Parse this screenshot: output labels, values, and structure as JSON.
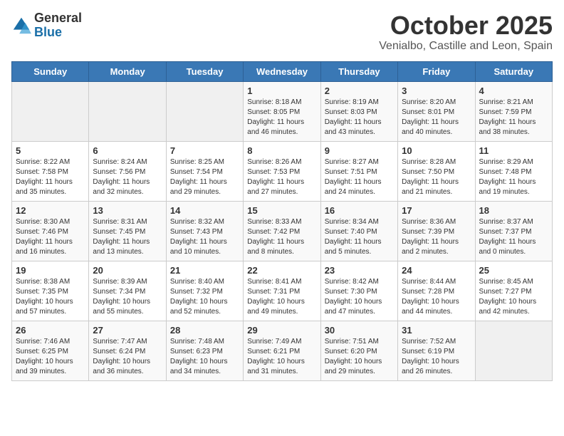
{
  "header": {
    "logo_general": "General",
    "logo_blue": "Blue",
    "month": "October 2025",
    "location": "Venialbo, Castille and Leon, Spain"
  },
  "weekdays": [
    "Sunday",
    "Monday",
    "Tuesday",
    "Wednesday",
    "Thursday",
    "Friday",
    "Saturday"
  ],
  "weeks": [
    [
      {
        "day": "",
        "info": ""
      },
      {
        "day": "",
        "info": ""
      },
      {
        "day": "",
        "info": ""
      },
      {
        "day": "1",
        "info": "Sunrise: 8:18 AM\nSunset: 8:05 PM\nDaylight: 11 hours\nand 46 minutes."
      },
      {
        "day": "2",
        "info": "Sunrise: 8:19 AM\nSunset: 8:03 PM\nDaylight: 11 hours\nand 43 minutes."
      },
      {
        "day": "3",
        "info": "Sunrise: 8:20 AM\nSunset: 8:01 PM\nDaylight: 11 hours\nand 40 minutes."
      },
      {
        "day": "4",
        "info": "Sunrise: 8:21 AM\nSunset: 7:59 PM\nDaylight: 11 hours\nand 38 minutes."
      }
    ],
    [
      {
        "day": "5",
        "info": "Sunrise: 8:22 AM\nSunset: 7:58 PM\nDaylight: 11 hours\nand 35 minutes."
      },
      {
        "day": "6",
        "info": "Sunrise: 8:24 AM\nSunset: 7:56 PM\nDaylight: 11 hours\nand 32 minutes."
      },
      {
        "day": "7",
        "info": "Sunrise: 8:25 AM\nSunset: 7:54 PM\nDaylight: 11 hours\nand 29 minutes."
      },
      {
        "day": "8",
        "info": "Sunrise: 8:26 AM\nSunset: 7:53 PM\nDaylight: 11 hours\nand 27 minutes."
      },
      {
        "day": "9",
        "info": "Sunrise: 8:27 AM\nSunset: 7:51 PM\nDaylight: 11 hours\nand 24 minutes."
      },
      {
        "day": "10",
        "info": "Sunrise: 8:28 AM\nSunset: 7:50 PM\nDaylight: 11 hours\nand 21 minutes."
      },
      {
        "day": "11",
        "info": "Sunrise: 8:29 AM\nSunset: 7:48 PM\nDaylight: 11 hours\nand 19 minutes."
      }
    ],
    [
      {
        "day": "12",
        "info": "Sunrise: 8:30 AM\nSunset: 7:46 PM\nDaylight: 11 hours\nand 16 minutes."
      },
      {
        "day": "13",
        "info": "Sunrise: 8:31 AM\nSunset: 7:45 PM\nDaylight: 11 hours\nand 13 minutes."
      },
      {
        "day": "14",
        "info": "Sunrise: 8:32 AM\nSunset: 7:43 PM\nDaylight: 11 hours\nand 10 minutes."
      },
      {
        "day": "15",
        "info": "Sunrise: 8:33 AM\nSunset: 7:42 PM\nDaylight: 11 hours\nand 8 minutes."
      },
      {
        "day": "16",
        "info": "Sunrise: 8:34 AM\nSunset: 7:40 PM\nDaylight: 11 hours\nand 5 minutes."
      },
      {
        "day": "17",
        "info": "Sunrise: 8:36 AM\nSunset: 7:39 PM\nDaylight: 11 hours\nand 2 minutes."
      },
      {
        "day": "18",
        "info": "Sunrise: 8:37 AM\nSunset: 7:37 PM\nDaylight: 11 hours\nand 0 minutes."
      }
    ],
    [
      {
        "day": "19",
        "info": "Sunrise: 8:38 AM\nSunset: 7:35 PM\nDaylight: 10 hours\nand 57 minutes."
      },
      {
        "day": "20",
        "info": "Sunrise: 8:39 AM\nSunset: 7:34 PM\nDaylight: 10 hours\nand 55 minutes."
      },
      {
        "day": "21",
        "info": "Sunrise: 8:40 AM\nSunset: 7:32 PM\nDaylight: 10 hours\nand 52 minutes."
      },
      {
        "day": "22",
        "info": "Sunrise: 8:41 AM\nSunset: 7:31 PM\nDaylight: 10 hours\nand 49 minutes."
      },
      {
        "day": "23",
        "info": "Sunrise: 8:42 AM\nSunset: 7:30 PM\nDaylight: 10 hours\nand 47 minutes."
      },
      {
        "day": "24",
        "info": "Sunrise: 8:44 AM\nSunset: 7:28 PM\nDaylight: 10 hours\nand 44 minutes."
      },
      {
        "day": "25",
        "info": "Sunrise: 8:45 AM\nSunset: 7:27 PM\nDaylight: 10 hours\nand 42 minutes."
      }
    ],
    [
      {
        "day": "26",
        "info": "Sunrise: 7:46 AM\nSunset: 6:25 PM\nDaylight: 10 hours\nand 39 minutes."
      },
      {
        "day": "27",
        "info": "Sunrise: 7:47 AM\nSunset: 6:24 PM\nDaylight: 10 hours\nand 36 minutes."
      },
      {
        "day": "28",
        "info": "Sunrise: 7:48 AM\nSunset: 6:23 PM\nDaylight: 10 hours\nand 34 minutes."
      },
      {
        "day": "29",
        "info": "Sunrise: 7:49 AM\nSunset: 6:21 PM\nDaylight: 10 hours\nand 31 minutes."
      },
      {
        "day": "30",
        "info": "Sunrise: 7:51 AM\nSunset: 6:20 PM\nDaylight: 10 hours\nand 29 minutes."
      },
      {
        "day": "31",
        "info": "Sunrise: 7:52 AM\nSunset: 6:19 PM\nDaylight: 10 hours\nand 26 minutes."
      },
      {
        "day": "",
        "info": ""
      }
    ]
  ]
}
